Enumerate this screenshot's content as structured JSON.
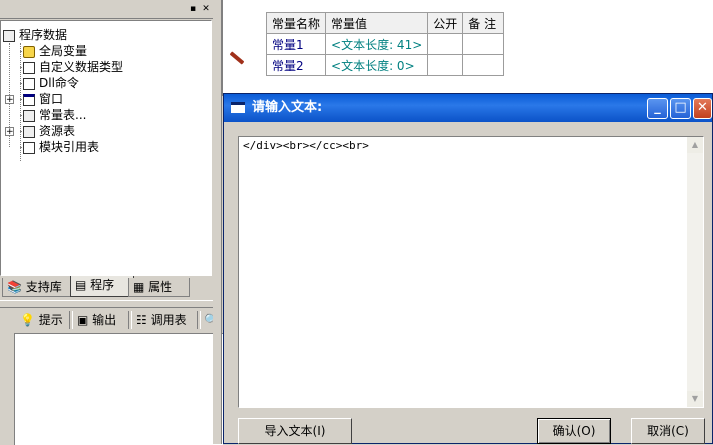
{
  "tree": {
    "root": "程序数据",
    "items": [
      {
        "label": "全局变量",
        "icon": "database-icon"
      },
      {
        "label": "自定义数据类型",
        "icon": "document-icon"
      },
      {
        "label": "Dll命令",
        "icon": "dll-icon"
      },
      {
        "label": "窗口",
        "icon": "window-icon"
      },
      {
        "label": "常量表...",
        "icon": "constants-icon"
      },
      {
        "label": "资源表",
        "icon": "resources-icon"
      },
      {
        "label": "模块引用表",
        "icon": "module-icon"
      }
    ]
  },
  "left_tabs": [
    "支持库",
    "程序",
    "属性"
  ],
  "bottom_toolbar": {
    "hint": "提示",
    "output": "输出",
    "calltable": "调用表"
  },
  "const_table": {
    "headers": [
      "常量名称",
      "常量值",
      "公开",
      "备 注"
    ],
    "rows": [
      {
        "name": "常量1",
        "value": "<文本长度: 41>"
      },
      {
        "name": "常量2",
        "value": "<文本长度: 0>"
      }
    ]
  },
  "dialog": {
    "title": "请输入文本:",
    "text": "</div><br></cc><br>",
    "import_button": "导入文本(I)",
    "ok_button": "确认(O)",
    "cancel_button": "取消(C)"
  },
  "colors": {
    "titlebar": "#0a5bd6",
    "const_name": "#000080",
    "const_value": "#008080"
  }
}
